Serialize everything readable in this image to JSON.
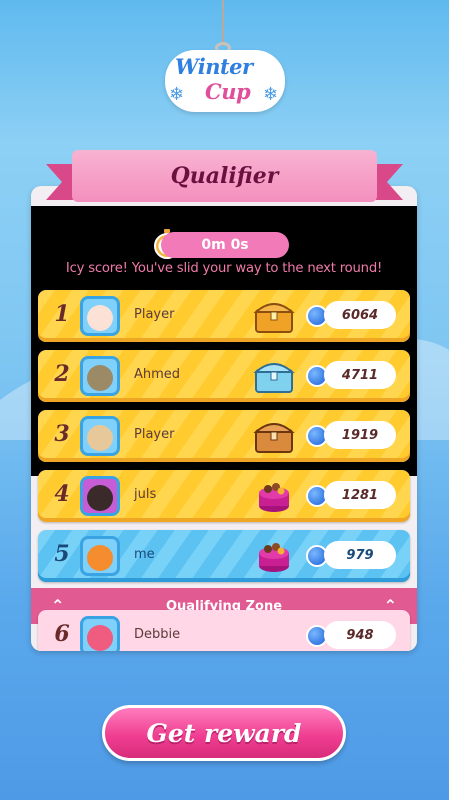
{
  "logo": {
    "line1": "Winter",
    "line2": "Cup"
  },
  "banner": {
    "title": "Qualifier"
  },
  "timer": {
    "value": "0m 0s"
  },
  "message": "Icy score! You've slid your way to the next round!",
  "leaderboard": {
    "rows": [
      {
        "rank": "1",
        "name": "Player",
        "score": "6064",
        "reward": "gold-chest-icon",
        "style": "gold"
      },
      {
        "rank": "2",
        "name": "Ahmed",
        "score": "4711",
        "reward": "silver-chest-icon",
        "style": "gold"
      },
      {
        "rank": "3",
        "name": "Player",
        "score": "1919",
        "reward": "bronze-chest-icon",
        "style": "gold"
      },
      {
        "rank": "4",
        "name": "juls",
        "score": "1281",
        "reward": "candy-box-icon",
        "style": "gold"
      },
      {
        "rank": "5",
        "name": "me",
        "score": "979",
        "reward": "candy-box-icon",
        "style": "blue"
      },
      {
        "rank": "6",
        "name": "Debbie",
        "score": "948",
        "reward": "",
        "style": "pink"
      }
    ],
    "zone_label": "Qualifying Zone"
  },
  "cta": {
    "label": "Get reward"
  },
  "colors": {
    "primary_pink": "#f03f92",
    "gold_row": "#ffd64d",
    "current_user_row": "#5cc2f2"
  }
}
